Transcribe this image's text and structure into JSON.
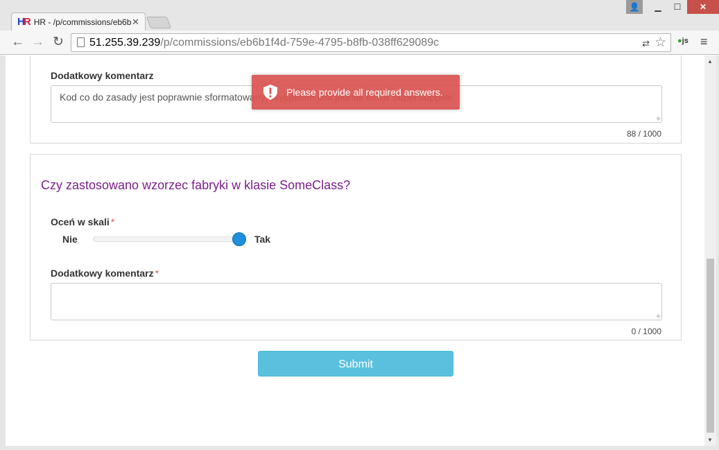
{
  "browser": {
    "tab_title": "HR - /p/commissions/eb6b",
    "favicon_h": "H",
    "favicon_r": "R",
    "url_host": "51.255.39.239",
    "url_path": "/p/commissions/eb6b1f4d-759e-4795-b8fb-038ff629089c",
    "ext_label": "js"
  },
  "previous_question": {
    "comment_label": "Dodatkowy komentarz",
    "comment_value": "Kod co do zasady jest poprawnie sformatowany. Wyjątkiem jest jednak klasa SuperSupplier.",
    "counter": "88 / 1000"
  },
  "question": {
    "title": "Czy zastosowano wzorzec fabryki w klasie SomeClass?",
    "scale_label": "Oceń w skali",
    "required_mark": "*",
    "scale_min_label": "Nie",
    "scale_max_label": "Tak",
    "scale_value": 1.0,
    "comment_label": "Dodatkowy komentarz",
    "comment_value": "",
    "counter": "0 / 1000"
  },
  "submit_label": "Submit",
  "toast": {
    "message": "Please provide all required answers.",
    "color": "#d9534f"
  },
  "colors": {
    "question_title": "#7b1f8c",
    "submit": "#5bc0de",
    "slider_thumb": "#1e8fd8"
  }
}
